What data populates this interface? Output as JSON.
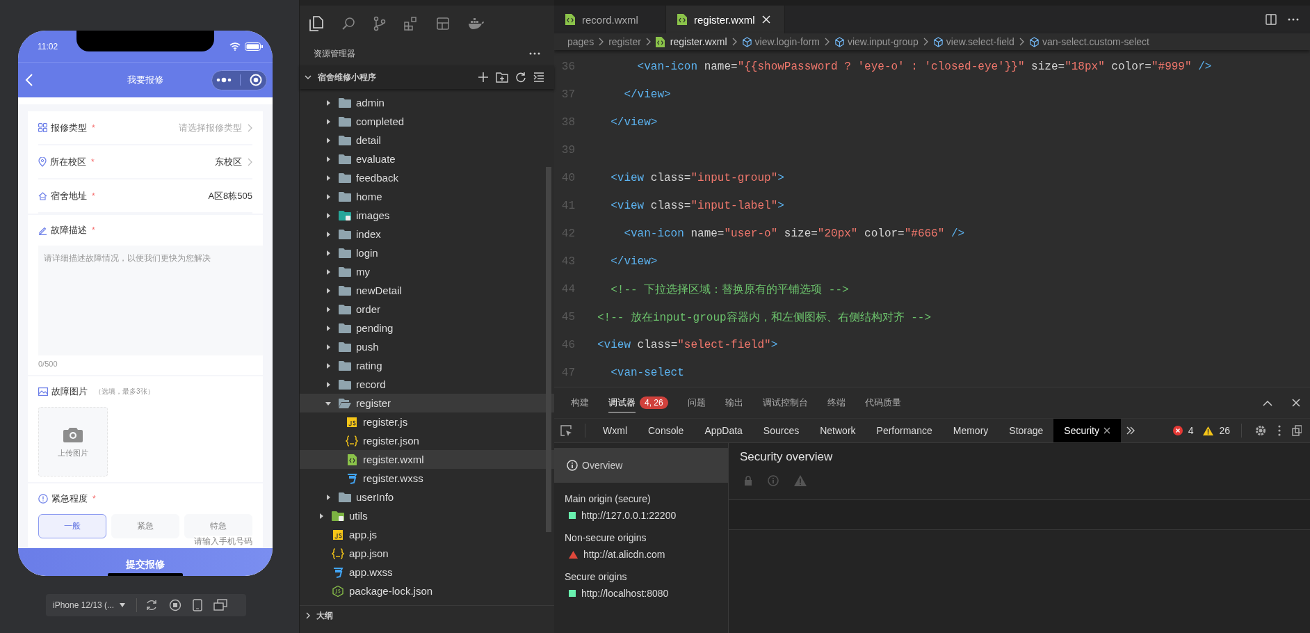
{
  "simulator": {
    "status_bar": {
      "time": "11:02"
    },
    "nav": {
      "title": "我要报修"
    },
    "form": {
      "rows": [
        {
          "kind": "picker",
          "label": "报修类型",
          "mark": "*",
          "placeholder": "请选择报修类型"
        },
        {
          "kind": "picker",
          "label": "所在校区",
          "mark": "*",
          "value": "东校区"
        },
        {
          "kind": "text",
          "label": "宿舍地址",
          "mark": "*",
          "value": "A区8栋505"
        }
      ],
      "description": {
        "label": "故障描述",
        "mark": "*",
        "placeholder": "请详细描述故障情况，以便我们更快为您解决",
        "counter": "0/500"
      },
      "photos": {
        "label": "故障图片",
        "hint": "（选填，最多3张）",
        "upload_label": "上传图片"
      },
      "urgency": {
        "label": "紧急程度",
        "mark": "*",
        "options": [
          {
            "label": "一般",
            "selected": true
          },
          {
            "label": "紧急",
            "selected": false
          },
          {
            "label": "特急",
            "selected": false
          }
        ]
      },
      "phone_placeholder": "请输入手机号码",
      "submit": "提交报修"
    },
    "device_toolbar": {
      "device": "iPhone 12/13 (..."
    }
  },
  "explorer": {
    "title": "资源管理器",
    "project": {
      "name": "宿舍维修小程序",
      "expanded": true
    },
    "tree": [
      {
        "children": [
          {
            "label": "admin",
            "kind": "folder",
            "expanded": false,
            "selected": false
          },
          {
            "label": "completed",
            "kind": "folder",
            "expanded": false,
            "selected": false
          },
          {
            "label": "detail",
            "kind": "folder",
            "expanded": false,
            "selected": false
          },
          {
            "label": "evaluate",
            "kind": "folder",
            "expanded": false,
            "selected": false
          },
          {
            "label": "feedback",
            "kind": "folder",
            "expanded": false,
            "selected": false
          },
          {
            "label": "home",
            "kind": "folder",
            "expanded": false,
            "selected": false
          },
          {
            "label": "images",
            "kind": "images-folder",
            "expanded": false,
            "selected": false
          },
          {
            "label": "index",
            "kind": "folder",
            "expanded": false,
            "selected": false
          },
          {
            "label": "login",
            "kind": "folder",
            "expanded": false,
            "selected": false
          },
          {
            "label": "my",
            "kind": "folder",
            "expanded": false,
            "selected": false
          },
          {
            "label": "newDetail",
            "kind": "folder",
            "expanded": false,
            "selected": false
          },
          {
            "label": "order",
            "kind": "folder",
            "expanded": false,
            "selected": false
          },
          {
            "label": "pending",
            "kind": "folder",
            "expanded": false,
            "selected": false
          },
          {
            "label": "push",
            "kind": "folder",
            "expanded": false,
            "selected": false
          },
          {
            "label": "rating",
            "kind": "folder",
            "expanded": false,
            "selected": false
          },
          {
            "label": "record",
            "kind": "folder",
            "expanded": false,
            "selected": false
          },
          {
            "label": "register",
            "kind": "folder",
            "expanded": true,
            "selected": true,
            "children": [
              {
                "label": "register.js",
                "kind": "js",
                "selected": false
              },
              {
                "label": "register.json",
                "kind": "json",
                "selected": false
              },
              {
                "label": "register.wxml",
                "kind": "wxml",
                "selected": true
              },
              {
                "label": "register.wxss",
                "kind": "wxss",
                "selected": false
              }
            ]
          },
          {
            "label": "userInfo",
            "kind": "folder",
            "expanded": false,
            "selected": false
          }
        ]
      },
      {
        "label": "utils",
        "kind": "utils-folder",
        "expanded": false,
        "selected": false
      },
      {
        "label": "app.js",
        "kind": "js",
        "selected": false
      },
      {
        "label": "app.json",
        "kind": "json",
        "selected": false
      },
      {
        "label": "app.wxss",
        "kind": "wxss",
        "selected": false
      },
      {
        "label": "package-lock.json",
        "kind": "package",
        "selected": false
      }
    ],
    "outline": {
      "label": "大纲",
      "expanded": false
    }
  },
  "editor": {
    "tabs": [
      {
        "label": "record.wxml",
        "selected": false
      },
      {
        "label": "register.wxml",
        "selected": true
      }
    ],
    "breadcrumb": [
      {
        "label": "pages",
        "kind": "folder"
      },
      {
        "label": "register",
        "kind": "folder"
      },
      {
        "label": "register.wxml",
        "kind": "file"
      },
      {
        "label": "view.login-form",
        "kind": "element"
      },
      {
        "label": "view.input-group",
        "kind": "element"
      },
      {
        "label": "view.select-field",
        "kind": "element"
      },
      {
        "label": "van-select.custom-select",
        "kind": "element"
      }
    ],
    "lines": [
      {
        "number": "36",
        "text": "      <van-icon name=\"{{showPassword ? 'eye-o' : 'closed-eye'}}\" size=\"18px\" color=\"#999\" />"
      },
      {
        "number": "37",
        "text": "    </view>"
      },
      {
        "number": "38",
        "text": "  </view>"
      },
      {
        "number": "39"
      },
      {
        "number": "40",
        "text": "  <view class=\"input-group\">"
      },
      {
        "number": "41",
        "text": "  <view class=\"input-label\">"
      },
      {
        "number": "42",
        "text": "    <van-icon name=\"user-o\" size=\"20px\" color=\"#666\" />"
      },
      {
        "number": "43",
        "text": "  </view>"
      },
      {
        "number": "44",
        "text": "  <!-- 下拉选择区域：替换原有的平铺选项 -->"
      },
      {
        "number": "45",
        "text": "<!-- 放在input-group容器内，和左侧图标、右侧结构对齐 -->"
      },
      {
        "number": "46",
        "text": "<view class=\"select-field\">"
      },
      {
        "number": "47",
        "text": "  <van-select"
      }
    ]
  },
  "panel": {
    "tabs": [
      {
        "label": "构建",
        "selected": false
      },
      {
        "label": "调试器",
        "selected": true,
        "badge": "4, 26"
      },
      {
        "label": "问题",
        "selected": false
      },
      {
        "label": "输出",
        "selected": false
      },
      {
        "label": "调试控制台",
        "selected": false
      },
      {
        "label": "终端",
        "selected": false
      },
      {
        "label": "代码质量",
        "selected": false
      }
    ]
  },
  "devtools": {
    "tabs": [
      {
        "label": "Wxml",
        "selected": false
      },
      {
        "label": "Console",
        "selected": false
      },
      {
        "label": "AppData",
        "selected": false
      },
      {
        "label": "Sources",
        "selected": false
      },
      {
        "label": "Network",
        "selected": false
      },
      {
        "label": "Performance",
        "selected": false
      },
      {
        "label": "Memory",
        "selected": false
      },
      {
        "label": "Storage",
        "selected": false
      },
      {
        "label": "Security",
        "selected": true
      }
    ],
    "error_count": "4",
    "warning_count": "26",
    "security": {
      "overview": {
        "label": "Overview",
        "selected": true
      },
      "groups": [
        {
          "heading": "Main origin (secure)",
          "origins": [
            {
              "url": "http://127.0.0.1:22200",
              "kind": "secure"
            }
          ]
        },
        {
          "heading": "Non-secure origins",
          "origins": [
            {
              "url": "http://at.alicdn.com",
              "kind": "insecure"
            }
          ]
        },
        {
          "heading": "Secure origins",
          "origins": [
            {
              "url": "http://localhost:8080",
              "kind": "secure"
            }
          ]
        }
      ],
      "title": "Security overview"
    }
  }
}
